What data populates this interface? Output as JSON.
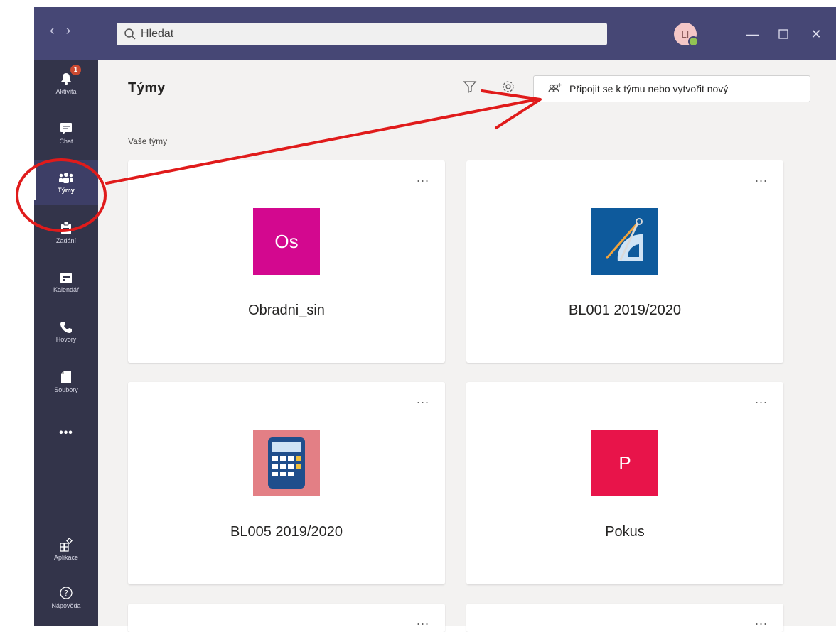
{
  "titlebar": {
    "back_icon": "chevron-left-icon",
    "forward_icon": "chevron-right-icon",
    "search": {
      "placeholder": "Hledat",
      "icon": "search-icon"
    },
    "avatar": {
      "initials": "LI",
      "status_color": "#92c353"
    },
    "window_controls": [
      "minimize-icon",
      "maximize-icon",
      "close-icon"
    ]
  },
  "rail": {
    "items": [
      {
        "label": "Aktivita",
        "icon": "bell-icon",
        "badge": "1"
      },
      {
        "label": "Chat",
        "icon": "chat-icon"
      },
      {
        "label": "Týmy",
        "icon": "teams-icon",
        "active": true
      },
      {
        "label": "Zadání",
        "icon": "assignments-icon"
      },
      {
        "label": "Kalendář",
        "icon": "calendar-icon"
      },
      {
        "label": "Hovory",
        "icon": "phone-icon"
      },
      {
        "label": "Soubory",
        "icon": "files-icon"
      },
      {
        "label": "•••",
        "icon": "more-icon"
      }
    ],
    "bottom": [
      {
        "label": "Aplikace",
        "icon": "apps-icon"
      },
      {
        "label": "Nápověda",
        "icon": "help-icon"
      }
    ]
  },
  "header": {
    "title": "Týmy",
    "filter_icon": "filter-icon",
    "settings_icon": "gear-icon",
    "join_button": "Připojit se k týmu nebo vytvořit nový"
  },
  "section": {
    "label": "Vaše týmy"
  },
  "teams": [
    {
      "name": "Obradni_sin",
      "tile_text": "Os",
      "tile_color": "#d3088f",
      "more": "..."
    },
    {
      "name": "BL001 2019/2020",
      "tile_text": "",
      "tile_color": "#0e5a9c",
      "icon": "geometry-tools-icon",
      "more": "..."
    },
    {
      "name": "BL005 2019/2020",
      "tile_text": "",
      "tile_color": "#e37f85",
      "icon": "calculator-icon",
      "more": "..."
    },
    {
      "name": "Pokus",
      "tile_text": "P",
      "tile_color": "#e8144a",
      "more": "..."
    },
    {
      "more": "..."
    },
    {
      "more": "..."
    }
  ],
  "colors": {
    "titlebar": "#464775",
    "rail": "#33344a",
    "annotation": "#e01b1b"
  }
}
